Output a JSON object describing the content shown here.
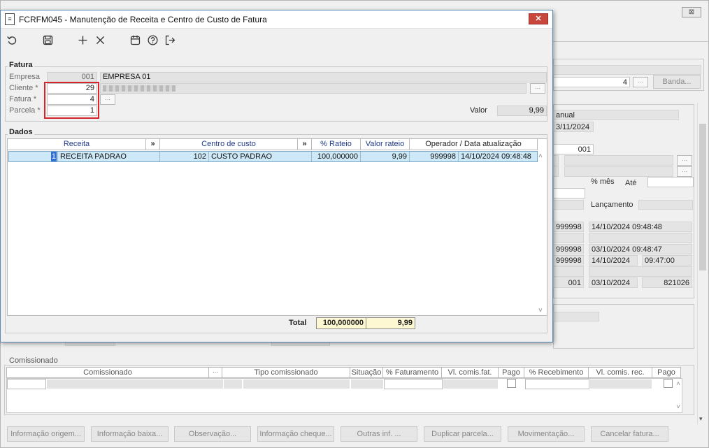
{
  "background": {
    "close_label": "⊠",
    "field_4": "4",
    "banda_button": "Banda...",
    "manual": "anual",
    "date_11_2024": "3/11/2024",
    "code_001": "001",
    "pct_mes": "% mês",
    "ate": "Até",
    "lancamento": "Lançamento",
    "op1": "999998",
    "dt1": "14/10/2024 09:48:48",
    "op2": "999998",
    "dt2": "03/10/2024 09:48:47",
    "op3": "999998",
    "dt3_date": "14/10/2024",
    "dt3_time": "09:47:00",
    "code2": "001",
    "dt4": "03/10/2024",
    "num4": "821026",
    "comissionado": {
      "title": "Comissionado",
      "headers": [
        "Comissionado",
        "Tipo comissionado",
        "Situação",
        "% Faturamento",
        "Vl. comis.fat.",
        "Pago",
        "% Recebimento",
        "Vl. comis. rec.",
        "Pago"
      ]
    },
    "buttons": [
      "Informação origem...",
      "Informação baixa...",
      "Observação...",
      "Informação cheque...",
      "Outras inf. ...",
      "Duplicar parcela...",
      "Movimentação...",
      "Cancelar fatura..."
    ]
  },
  "dialog": {
    "title": "FCRFM045 - Manutenção de Receita e Centro de Custo de Fatura",
    "close_label": "✕",
    "fatura": {
      "title": "Fatura",
      "empresa_label": "Empresa",
      "empresa_code": "001",
      "empresa_name": "EMPRESA 01",
      "cliente_label": "Cliente *",
      "cliente_value": "29",
      "fatura_label": "Fatura *",
      "fatura_value": "4",
      "parcela_label": "Parcela *",
      "parcela_value": "1",
      "valor_label": "Valor",
      "valor_value": "9,99"
    },
    "dados": {
      "title": "Dados",
      "headers": {
        "receita": "Receita",
        "expand1": "»",
        "centro": "Centro de custo",
        "expand2": "»",
        "rateio": "% Rateio",
        "valor_rateio": "Valor rateio",
        "operador": "Operador / Data atualização"
      },
      "rows": [
        {
          "receita_code": "1",
          "receita_name": "RECEITA PADRAO",
          "centro_code": "102",
          "centro_name": "CUSTO PADRAO",
          "rateio": "100,000000",
          "valor_rateio": "9,99",
          "operador": "999998",
          "data": "14/10/2024 09:48:48"
        }
      ],
      "total_label": "Total",
      "total_rateio": "100,000000",
      "total_valor": "9,99"
    }
  }
}
